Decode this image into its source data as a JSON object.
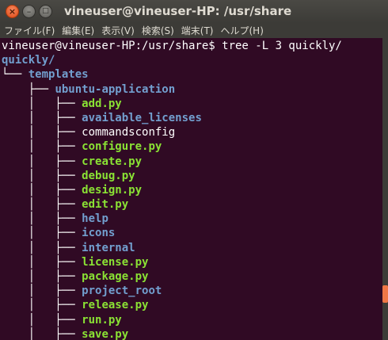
{
  "window": {
    "title": "vineuser@vineuser-HP: /usr/share",
    "close_glyph": "×",
    "minimize_glyph": "–",
    "maximize_glyph": "□"
  },
  "menu": [
    "ファイル(F)",
    "編集(E)",
    "表示(V)",
    "検索(S)",
    "端末(T)",
    "ヘルプ(H)"
  ],
  "terminal": {
    "prompt": "vineuser@vineuser-HP:/usr/share$ tree -L 3 quickly/",
    "root_dir": "quickly/",
    "tree_lines": [
      {
        "prefix": "└── ",
        "name": "templates",
        "kind": "dir"
      },
      {
        "prefix": "    ├── ",
        "name": "ubuntu-application",
        "kind": "dir"
      },
      {
        "prefix": "    │   ├── ",
        "name": "add.py",
        "kind": "exe"
      },
      {
        "prefix": "    │   ├── ",
        "name": "available_licenses",
        "kind": "dir"
      },
      {
        "prefix": "    │   ├── ",
        "name": "commandsconfig",
        "kind": "file"
      },
      {
        "prefix": "    │   ├── ",
        "name": "configure.py",
        "kind": "exe"
      },
      {
        "prefix": "    │   ├── ",
        "name": "create.py",
        "kind": "exe"
      },
      {
        "prefix": "    │   ├── ",
        "name": "debug.py",
        "kind": "exe"
      },
      {
        "prefix": "    │   ├── ",
        "name": "design.py",
        "kind": "exe"
      },
      {
        "prefix": "    │   ├── ",
        "name": "edit.py",
        "kind": "exe"
      },
      {
        "prefix": "    │   ├── ",
        "name": "help",
        "kind": "dir"
      },
      {
        "prefix": "    │   ├── ",
        "name": "icons",
        "kind": "dir"
      },
      {
        "prefix": "    │   ├── ",
        "name": "internal",
        "kind": "dir"
      },
      {
        "prefix": "    │   ├── ",
        "name": "license.py",
        "kind": "exe"
      },
      {
        "prefix": "    │   ├── ",
        "name": "package.py",
        "kind": "exe"
      },
      {
        "prefix": "    │   ├── ",
        "name": "project_root",
        "kind": "dir"
      },
      {
        "prefix": "    │   ├── ",
        "name": "release.py",
        "kind": "exe"
      },
      {
        "prefix": "    │   ├── ",
        "name": "run.py",
        "kind": "exe"
      },
      {
        "prefix": "    │   ├── ",
        "name": "save.py",
        "kind": "exe"
      }
    ]
  },
  "colors": {
    "background": "#300a24",
    "directory": "#729fcf",
    "executable": "#8ae234",
    "plain_file": "#ffffff",
    "titlebar": "#3c3b37",
    "close_button": "#df4a16",
    "scroll_thumb": "#f07746"
  },
  "icons": {
    "close": "close-icon",
    "minimize": "minimize-icon",
    "maximize": "maximize-icon"
  }
}
